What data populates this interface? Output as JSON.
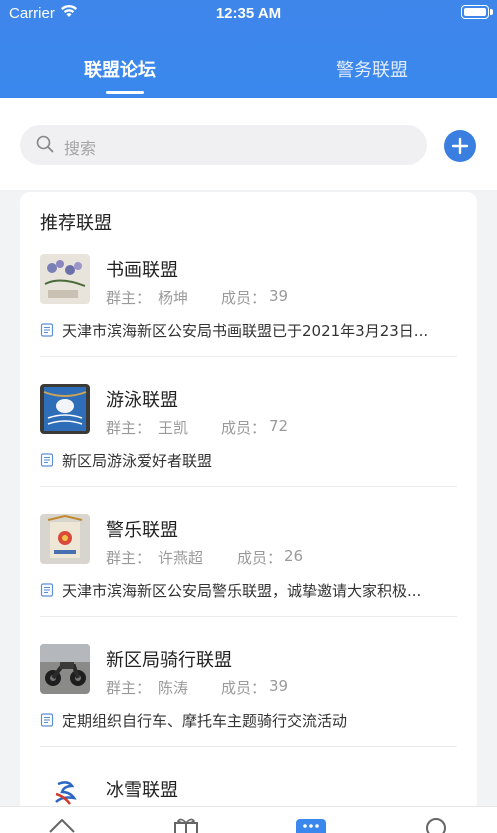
{
  "status_bar": {
    "carrier": "Carrier",
    "time": "12:35 AM"
  },
  "tabs": [
    {
      "label": "联盟论坛",
      "active": true
    },
    {
      "label": "警务联盟",
      "active": false
    }
  ],
  "search": {
    "placeholder": "搜索"
  },
  "section_title": "推荐联盟",
  "items": [
    {
      "name": "书画联盟",
      "owner_label": "群主：",
      "owner": "杨坤",
      "members_label": "成员：",
      "members": "39",
      "desc": "天津市滨海新区公安局书画联盟已于2021年3月23日..."
    },
    {
      "name": "游泳联盟",
      "owner_label": "群主：",
      "owner": "王凯",
      "members_label": "成员：",
      "members": "72",
      "desc": "新区局游泳爱好者联盟"
    },
    {
      "name": "警乐联盟",
      "owner_label": "群主：",
      "owner": "许燕超",
      "members_label": "成员：",
      "members": "26",
      "desc": "天津市滨海新区公安局警乐联盟，诚挚邀请大家积极..."
    },
    {
      "name": "新区局骑行联盟",
      "owner_label": "群主：",
      "owner": "陈涛",
      "members_label": "成员：",
      "members": "39",
      "desc": "定期组织自行车、摩托车主题骑行交流活动"
    },
    {
      "name": "冰雪联盟"
    }
  ],
  "colors": {
    "accent": "#3a88ee",
    "text": "#222222",
    "muted": "#9a9a9a"
  },
  "icons": {
    "search": "search-icon",
    "add": "plus-icon",
    "desc": "document-icon"
  }
}
